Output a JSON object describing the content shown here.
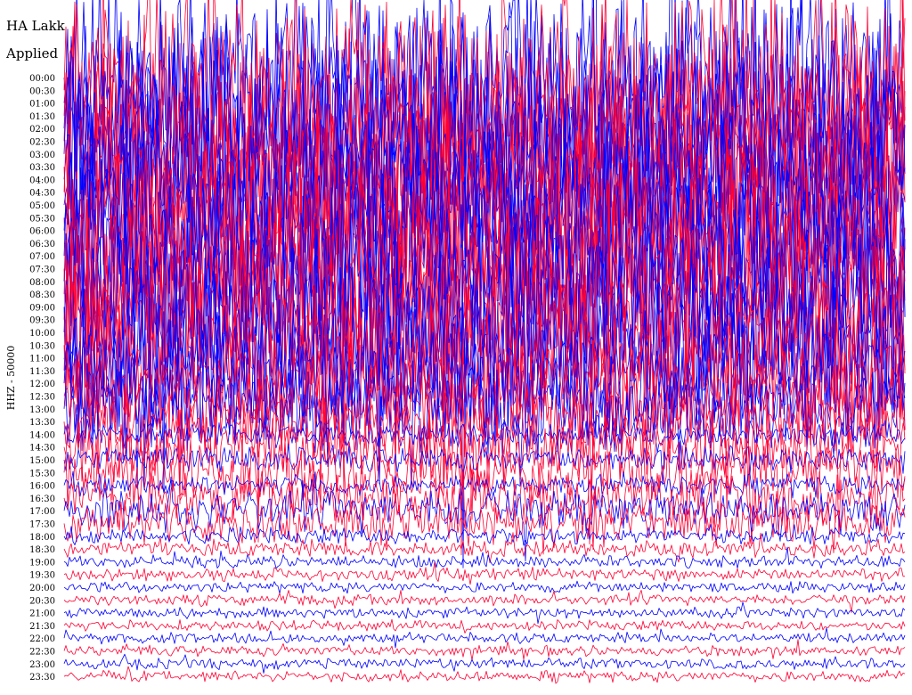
{
  "chart_data": {
    "type": "line",
    "title": "HA Lakk",
    "subtitle": "Applied",
    "ylabel": "HHZ - 50000",
    "xlabel": "",
    "grid": false,
    "legend": "none",
    "colors": {
      "series_a": "#0000ff",
      "series_b": "#ff0033",
      "text": "#000000",
      "background": "#ffffff"
    },
    "rows": [
      {
        "time": "00:00",
        "color": "#0000ff",
        "amplitude": 1.0
      },
      {
        "time": "00:30",
        "color": "#ff0033",
        "amplitude": 1.0
      },
      {
        "time": "01:00",
        "color": "#0000ff",
        "amplitude": 1.0
      },
      {
        "time": "01:30",
        "color": "#ff0033",
        "amplitude": 1.0
      },
      {
        "time": "02:00",
        "color": "#0000ff",
        "amplitude": 1.0
      },
      {
        "time": "02:30",
        "color": "#ff0033",
        "amplitude": 1.0
      },
      {
        "time": "03:00",
        "color": "#0000ff",
        "amplitude": 1.0
      },
      {
        "time": "03:30",
        "color": "#ff0033",
        "amplitude": 1.0
      },
      {
        "time": "04:00",
        "color": "#0000ff",
        "amplitude": 1.0
      },
      {
        "time": "04:30",
        "color": "#ff0033",
        "amplitude": 1.0
      },
      {
        "time": "05:00",
        "color": "#0000ff",
        "amplitude": 1.0
      },
      {
        "time": "05:30",
        "color": "#ff0033",
        "amplitude": 1.0
      },
      {
        "time": "06:00",
        "color": "#0000ff",
        "amplitude": 1.0
      },
      {
        "time": "06:30",
        "color": "#ff0033",
        "amplitude": 1.0
      },
      {
        "time": "07:00",
        "color": "#0000ff",
        "amplitude": 1.0
      },
      {
        "time": "07:30",
        "color": "#ff0033",
        "amplitude": 1.0
      },
      {
        "time": "08:00",
        "color": "#0000ff",
        "amplitude": 1.0
      },
      {
        "time": "08:30",
        "color": "#ff0033",
        "amplitude": 1.0
      },
      {
        "time": "09:00",
        "color": "#0000ff",
        "amplitude": 1.0
      },
      {
        "time": "09:30",
        "color": "#ff0033",
        "amplitude": 0.95
      },
      {
        "time": "10:00",
        "color": "#0000ff",
        "amplitude": 0.9
      },
      {
        "time": "10:30",
        "color": "#ff0033",
        "amplitude": 0.85
      },
      {
        "time": "11:00",
        "color": "#0000ff",
        "amplitude": 0.75
      },
      {
        "time": "11:30",
        "color": "#ff0033",
        "amplitude": 0.65
      },
      {
        "time": "12:00",
        "color": "#0000ff",
        "amplitude": 0.55
      },
      {
        "time": "12:30",
        "color": "#ff0033",
        "amplitude": 0.5
      },
      {
        "time": "13:00",
        "color": "#0000ff",
        "amplitude": 0.45
      },
      {
        "time": "13:30",
        "color": "#ff0033",
        "amplitude": 0.4
      },
      {
        "time": "14:00",
        "color": "#0000ff",
        "amplitude": 0.12
      },
      {
        "time": "14:30",
        "color": "#ff0033",
        "amplitude": 0.35
      },
      {
        "time": "15:00",
        "color": "#0000ff",
        "amplitude": 0.12
      },
      {
        "time": "15:30",
        "color": "#ff0033",
        "amplitude": 0.3
      },
      {
        "time": "16:00",
        "color": "#0000ff",
        "amplitude": 0.1
      },
      {
        "time": "16:30",
        "color": "#ff0033",
        "amplitude": 0.25
      },
      {
        "time": "17:00",
        "color": "#0000ff",
        "amplitude": 0.2
      },
      {
        "time": "17:30",
        "color": "#ff0033",
        "amplitude": 0.2
      },
      {
        "time": "18:00",
        "color": "#0000ff",
        "amplitude": 0.08
      },
      {
        "time": "18:30",
        "color": "#ff0033",
        "amplitude": 0.08
      },
      {
        "time": "19:00",
        "color": "#0000ff",
        "amplitude": 0.06
      },
      {
        "time": "19:30",
        "color": "#ff0033",
        "amplitude": 0.06
      },
      {
        "time": "20:00",
        "color": "#0000ff",
        "amplitude": 0.05
      },
      {
        "time": "20:30",
        "color": "#ff0033",
        "amplitude": 0.05
      },
      {
        "time": "21:00",
        "color": "#0000ff",
        "amplitude": 0.05
      },
      {
        "time": "21:30",
        "color": "#ff0033",
        "amplitude": 0.05
      },
      {
        "time": "22:00",
        "color": "#0000ff",
        "amplitude": 0.05
      },
      {
        "time": "22:30",
        "color": "#ff0033",
        "amplitude": 0.05
      },
      {
        "time": "23:00",
        "color": "#0000ff",
        "amplitude": 0.05
      },
      {
        "time": "23:30",
        "color": "#ff0033",
        "amplitude": 0.05
      }
    ]
  }
}
